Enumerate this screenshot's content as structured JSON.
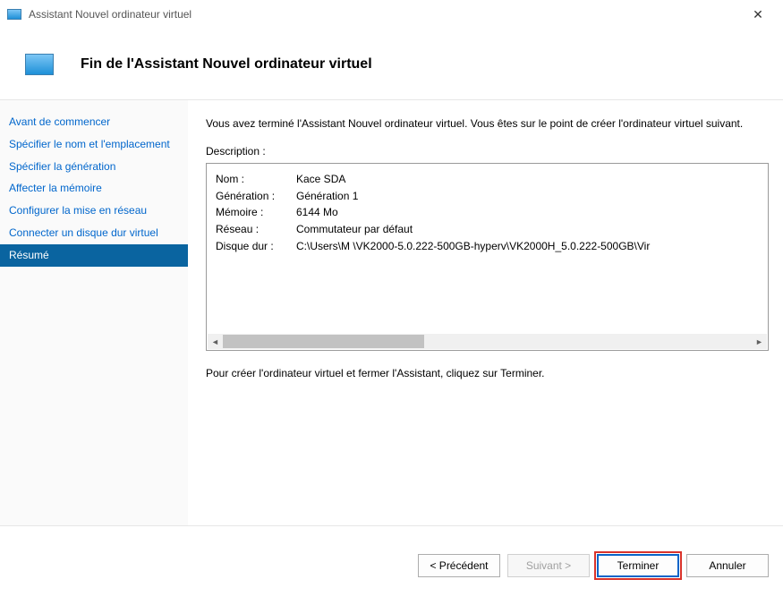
{
  "window": {
    "title": "Assistant Nouvel ordinateur virtuel"
  },
  "header": {
    "title": "Fin de l'Assistant Nouvel ordinateur virtuel"
  },
  "sidebar": {
    "items": [
      {
        "label": "Avant de commencer"
      },
      {
        "label": "Spécifier le nom et l'emplacement"
      },
      {
        "label": "Spécifier la génération"
      },
      {
        "label": "Affecter la mémoire"
      },
      {
        "label": "Configurer la mise en réseau"
      },
      {
        "label": "Connecter un disque dur virtuel"
      },
      {
        "label": "Résumé"
      }
    ],
    "selectedIndex": 6
  },
  "main": {
    "intro": "Vous avez terminé l'Assistant Nouvel ordinateur virtuel. Vous êtes sur le point de créer l'ordinateur virtuel suivant.",
    "descriptionLabel": "Description :",
    "summary": [
      {
        "key": "Nom :",
        "value": "Kace SDA"
      },
      {
        "key": "Génération :",
        "value": "Génération 1"
      },
      {
        "key": "Mémoire :",
        "value": "6144 Mo"
      },
      {
        "key": "Réseau :",
        "value": "Commutateur par défaut"
      },
      {
        "key": "Disque dur :",
        "value": "C:\\Users\\M           \\VK2000-5.0.222-500GB-hyperv\\VK2000H_5.0.222-500GB\\Vir"
      }
    ],
    "footnote": "Pour créer l'ordinateur virtuel et fermer l'Assistant, cliquez sur Terminer."
  },
  "footer": {
    "back": "< Précédent",
    "next": "Suivant >",
    "finish": "Terminer",
    "cancel": "Annuler"
  }
}
